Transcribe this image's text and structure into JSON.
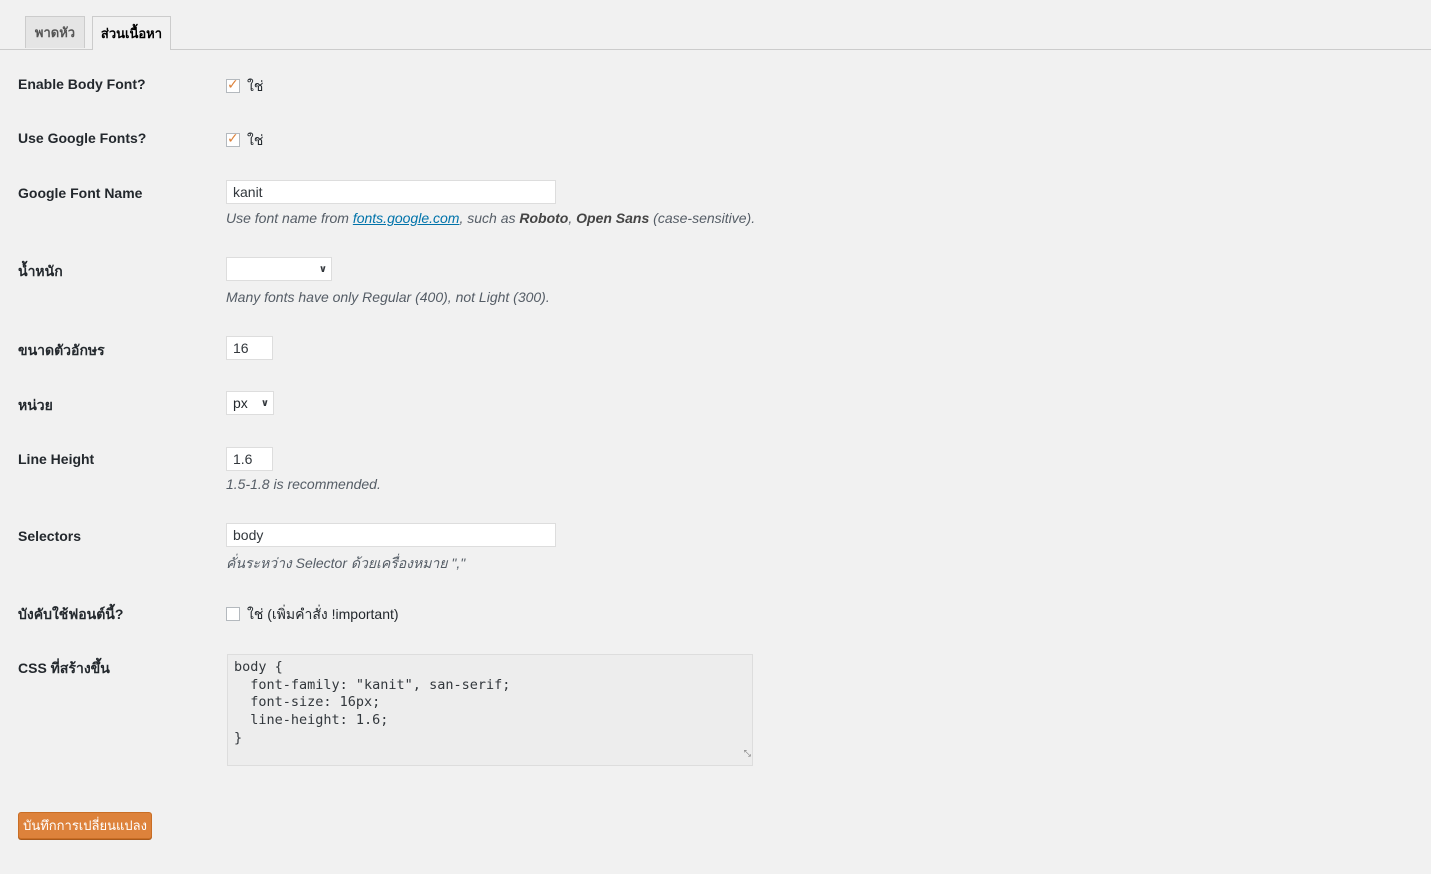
{
  "tabs": [
    {
      "label": "พาดหัว",
      "active": false
    },
    {
      "label": "ส่วนเนื้อหา",
      "active": true
    }
  ],
  "fields": {
    "enable_body_font": {
      "label": "Enable Body Font?",
      "checked": true,
      "option": "ใช่"
    },
    "use_google_fonts": {
      "label": "Use Google Fonts?",
      "checked": true,
      "option": "ใช่"
    },
    "google_font_name": {
      "label": "Google Font Name",
      "value": "kanit",
      "desc_prefix": "Use font name from ",
      "desc_link": "fonts.google.com",
      "desc_mid": ", such as ",
      "desc_ex1": "Roboto",
      "desc_sep": ", ",
      "desc_ex2": "Open Sans",
      "desc_suffix": " (case-sensitive)."
    },
    "weight": {
      "label": "น้ำหนัก",
      "value": "",
      "desc": "Many fonts have only Regular (400), not Light (300)."
    },
    "font_size": {
      "label": "ขนาดตัวอักษร",
      "value": "16"
    },
    "unit": {
      "label": "หน่วย",
      "value": "px"
    },
    "line_height": {
      "label": "Line Height",
      "value": "1.6",
      "desc": "1.5-1.8 is recommended."
    },
    "selectors": {
      "label": "Selectors",
      "value": "body",
      "desc": "คั่นระหว่าง Selector ด้วยเครื่องหมาย \",\""
    },
    "force_font": {
      "label": "บังคับใช้ฟอนต์นี้?",
      "checked": false,
      "option": "ใช่ (เพิ่มคำสั่ง !important)"
    },
    "generated_css": {
      "label": "CSS ที่สร้างขึ้น",
      "value": "body {\n  font-family: \"kanit\", san-serif;\n  font-size: 16px;\n  line-height: 1.6;\n}"
    }
  },
  "save_button": "บันทึกการเปลี่ยนแปลง",
  "colors": {
    "accent": "#dd823b",
    "link": "#0073aa",
    "background": "#f1f1f1"
  }
}
